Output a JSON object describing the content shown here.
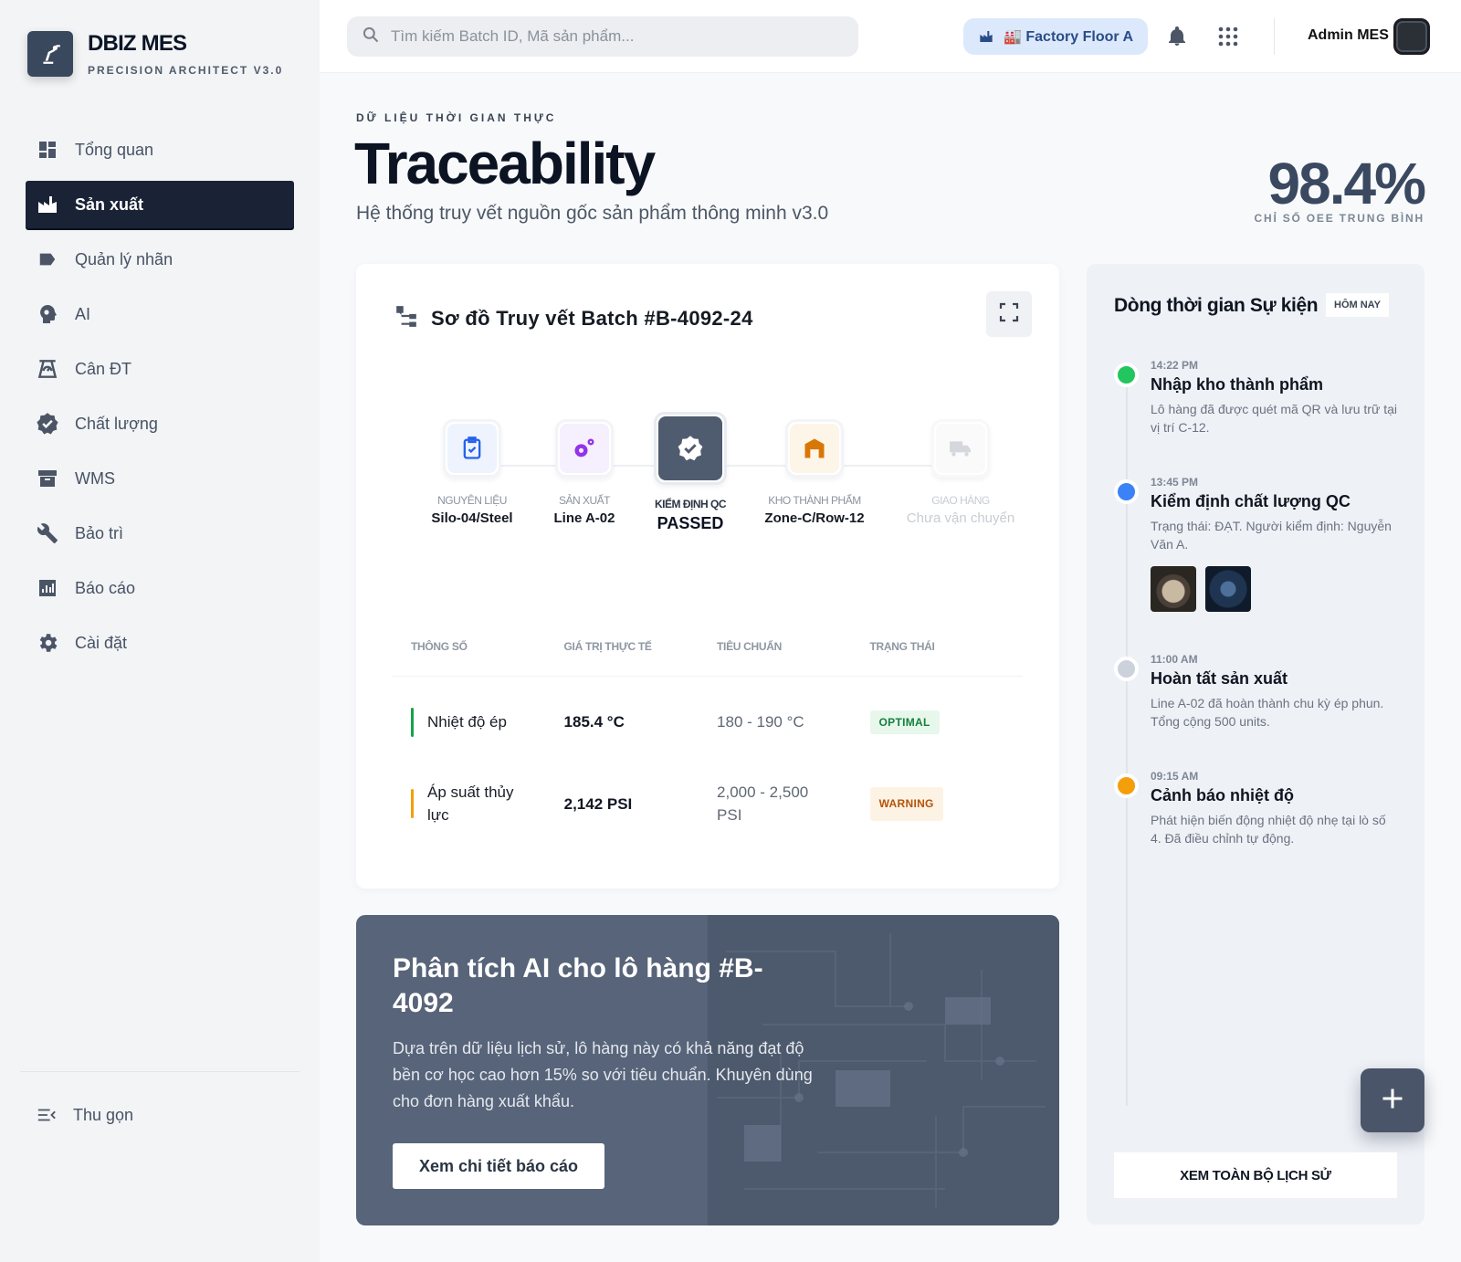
{
  "brand": {
    "title": "DBIZ MES",
    "subtitle": "PRECISION ARCHITECT V3.0",
    "logo_icon": "robot-arm-icon"
  },
  "nav": {
    "items": [
      {
        "label": "Tổng quan",
        "icon": "dashboard-icon",
        "active": false
      },
      {
        "label": "Sản xuất",
        "icon": "factory-icon",
        "active": true
      },
      {
        "label": "Quản lý nhãn",
        "icon": "label-icon",
        "active": false
      },
      {
        "label": "AI",
        "icon": "ai-head-icon",
        "active": false
      },
      {
        "label": "Cân ĐT",
        "icon": "scale-icon",
        "active": false
      },
      {
        "label": "Chất lượng",
        "icon": "verified-icon",
        "active": false
      },
      {
        "label": "WMS",
        "icon": "archive-icon",
        "active": false
      },
      {
        "label": "Bảo trì",
        "icon": "wrench-icon",
        "active": false
      },
      {
        "label": "Báo cáo",
        "icon": "chart-icon",
        "active": false
      },
      {
        "label": "Cài đặt",
        "icon": "gear-icon",
        "active": false
      }
    ],
    "collapse_label": "Thu gọn"
  },
  "topbar": {
    "search_placeholder": "Tìm kiếm Batch ID, Mã sản phẩm...",
    "factory_label": "🏭 Factory Floor A",
    "admin_name": "Admin MES"
  },
  "header": {
    "eyebrow": "DỮ LIỆU THỜI GIAN THỰC",
    "title": "Traceability",
    "subtitle": "Hệ thống truy vết nguồn gốc sản phẩm thông minh v3.0",
    "oee_value": "98.4%",
    "oee_label": "CHỈ SỐ OEE TRUNG BÌNH"
  },
  "trace": {
    "title": "Sơ đồ Truy vết Batch #B-4092-24",
    "steps": [
      {
        "label": "NGUYÊN LIỆU",
        "value": "Silo-04/Steel",
        "icon": "clipboard-check-icon",
        "color": "#2563eb",
        "bg": "#eef3fd"
      },
      {
        "label": "SẢN XUẤT",
        "value": "Line A-02",
        "icon": "gears-icon",
        "color": "#9333ea",
        "bg": "#f6effd"
      },
      {
        "label": "KIỂM ĐỊNH QC",
        "value": "PASSED",
        "icon": "verified-badge-icon",
        "color": "#ffffff",
        "bg": "#4f5b6e"
      },
      {
        "label": "KHO THÀNH PHẨM",
        "value": "Zone-C/Row-12",
        "icon": "warehouse-icon",
        "color": "#d97706",
        "bg": "#fdf5e8"
      },
      {
        "label": "GIAO HÀNG",
        "value": "Chưa vận chuyển",
        "icon": "truck-icon",
        "color": "#d1d5db",
        "bg": "#fafafa"
      }
    ],
    "table": {
      "headers": [
        "THÔNG SỐ",
        "GIÁ TRỊ THỰC TẾ",
        "TIÊU CHUẨN",
        "TRẠNG THÁI"
      ],
      "rows": [
        {
          "param": "Nhiệt độ ép",
          "value": "185.4 °C",
          "standard": "180 - 190 °C",
          "status": "OPTIMAL",
          "accent": "#16a34a",
          "badge_bg": "#e8f7ec",
          "badge_fg": "#15803d"
        },
        {
          "param": "Áp suất thủy lực",
          "value": "2,142 PSI",
          "standard": "2,000 - 2,500 PSI",
          "status": "WARNING",
          "accent": "#f59e0b",
          "badge_bg": "#fdf3e4",
          "badge_fg": "#b45309"
        }
      ]
    }
  },
  "ai": {
    "title": "Phân tích AI cho lô hàng #B-4092",
    "description": "Dựa trên dữ liệu lịch sử, lô hàng này có khả năng đạt độ bền cơ học cao hơn 15% so với tiêu chuẩn. Khuyên dùng cho đơn hàng xuất khẩu.",
    "button": "Xem chi tiết báo cáo"
  },
  "timeline": {
    "title": "Dòng thời gian Sự kiện",
    "badge": "HÔM NAY",
    "events": [
      {
        "time": "14:22 PM",
        "title": "Nhập kho thành phẩm",
        "text": "Lô hàng đã được quét mã QR và lưu trữ tại vị trí C-12.",
        "color": "#22c55e"
      },
      {
        "time": "13:45 PM",
        "title": "Kiểm định chất lượng QC",
        "text": "Trạng thái: ĐẠT. Người kiểm định: Nguyễn Văn A.",
        "color": "#3b82f6"
      },
      {
        "time": "11:00 AM",
        "title": "Hoàn tất sản xuất",
        "text": "Line A-02 đã hoàn thành chu kỳ ép phun. Tổng cộng 500 units.",
        "color": "#cbd2dc"
      },
      {
        "time": "09:15 AM",
        "title": "Cảnh báo nhiệt độ",
        "text": "Phát hiện biến động nhiệt độ nhẹ tại lò số 4. Đã điều chỉnh tự động.",
        "color": "#f59e0b"
      }
    ],
    "history_button": "XEM TOÀN BỘ LỊCH SỬ"
  }
}
